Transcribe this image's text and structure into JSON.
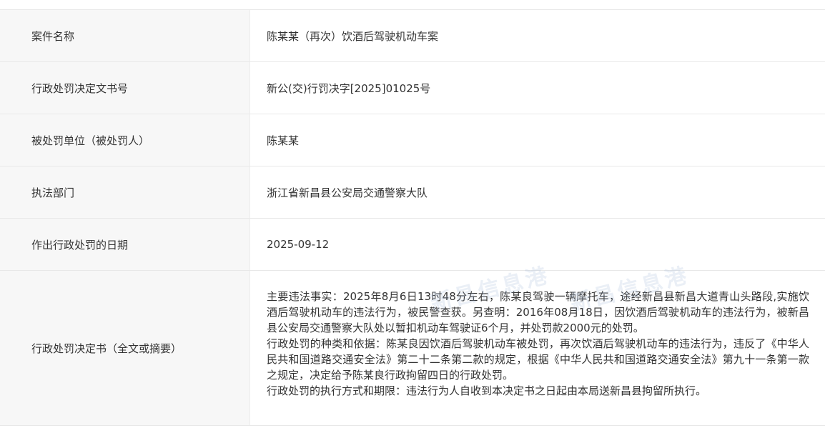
{
  "rows": [
    {
      "label": "案件名称",
      "value": "陈某某（再次）饮酒后驾驶机动车案"
    },
    {
      "label": "行政处罚决定文书号",
      "value": "新公(交)行罚决字[2025]01025号"
    },
    {
      "label": "被处罚单位（被处罚人）",
      "value": "陈某某"
    },
    {
      "label": "执法部门",
      "value": "浙江省新昌县公安局交通警察大队"
    },
    {
      "label": "作出行政处罚的日期",
      "value": "2025-09-12"
    },
    {
      "label": "行政处罚决定书（全文或摘要）",
      "paragraphs": [
        "主要违法事实：2025年8月6日13时48分左右，陈某良驾驶一辆摩托车，途经新昌县新昌大道青山头路段,实施饮酒后驾驶机动车的违法行为，被民警查获。另查明：2016年08月18日，因饮酒后驾驶机动车的违法行为，被新昌县公安局交通警察大队处以暂扣机动车驾驶证6个月，并处罚款2000元的处罚。",
        "行政处罚的种类和依据：陈某良因饮酒后驾驶机动车被处罚，再次饮酒后驾驶机动车的违法行为，违反了《中华人民共和国道路交通安全法》第二十二条第二款的规定，根据《中华人民共和国道路交通安全法》第九十一条第一款之规定，决定给予陈某良行政拘留四日的行政处罚。",
        "行政处罚的执行方式和期限：违法行为人自收到本决定书之日起由本局送新昌县拘留所执行。"
      ]
    }
  ],
  "watermark": "新昌信息港"
}
